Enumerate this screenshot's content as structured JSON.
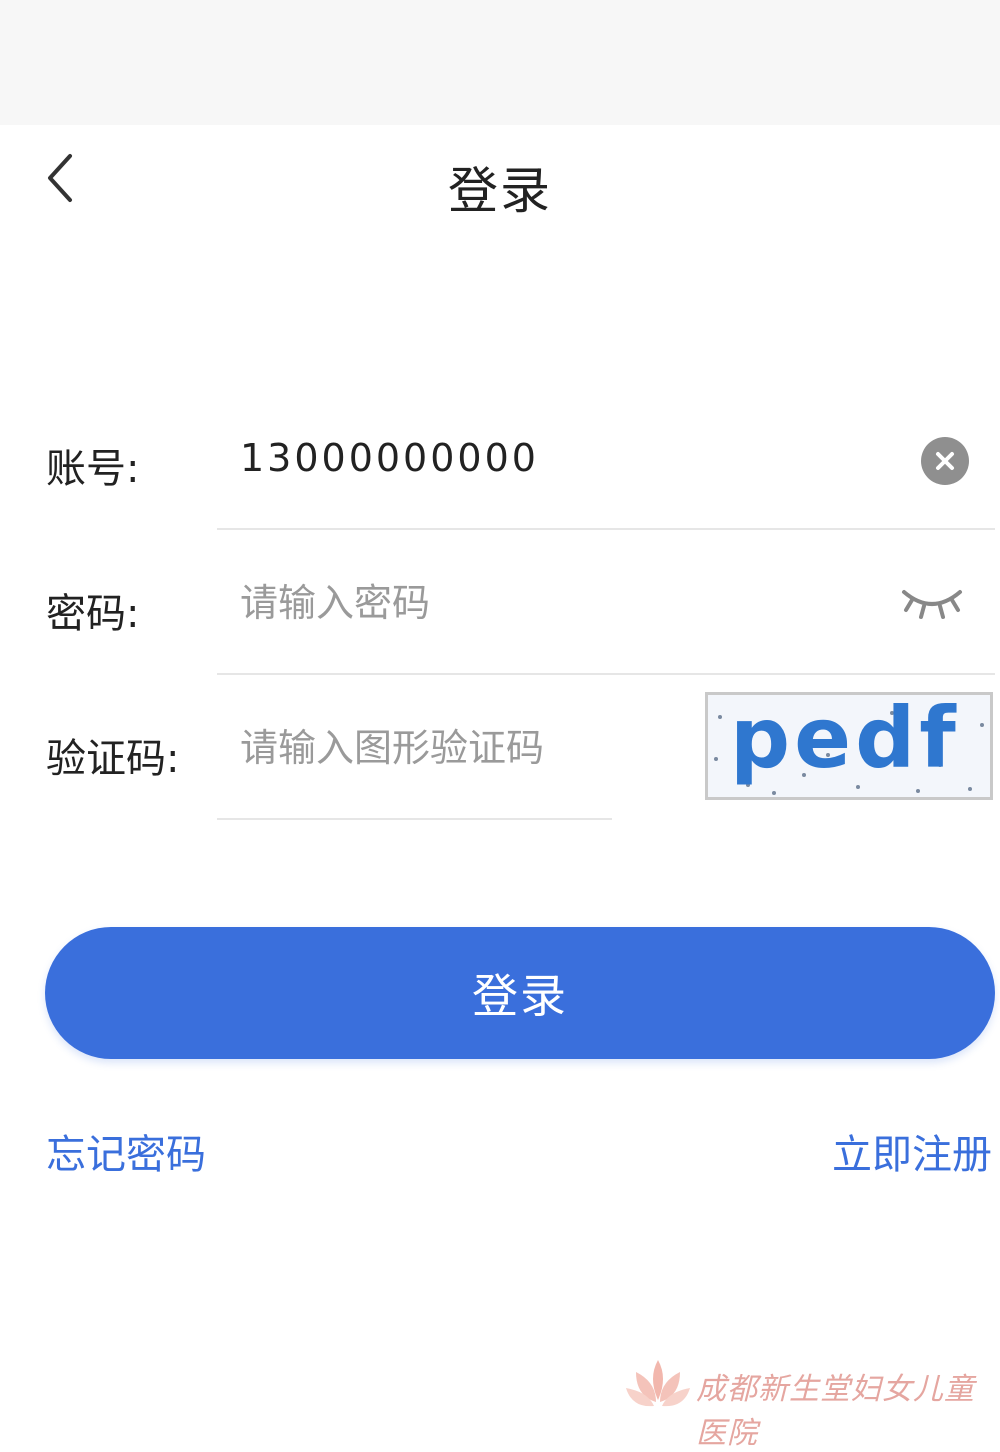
{
  "header": {
    "title": "登录",
    "back_icon": "chevron-left-icon"
  },
  "form": {
    "account": {
      "label": "账号:",
      "value": "13000000000",
      "clear_icon": "clear-circle-icon"
    },
    "password": {
      "label": "密码:",
      "placeholder": "请输入密码",
      "toggle_icon": "eye-closed-icon"
    },
    "captcha": {
      "label": "验证码:",
      "placeholder": "请输入图形验证码",
      "image_text": "pedf"
    }
  },
  "actions": {
    "login_label": "登录",
    "forgot_label": "忘记密码",
    "register_label": "立即注册"
  },
  "footer": {
    "watermark": "成都新生堂妇女儿童医院"
  },
  "colors": {
    "accent": "#3a6fdc",
    "captcha_text": "#2f77cf"
  }
}
